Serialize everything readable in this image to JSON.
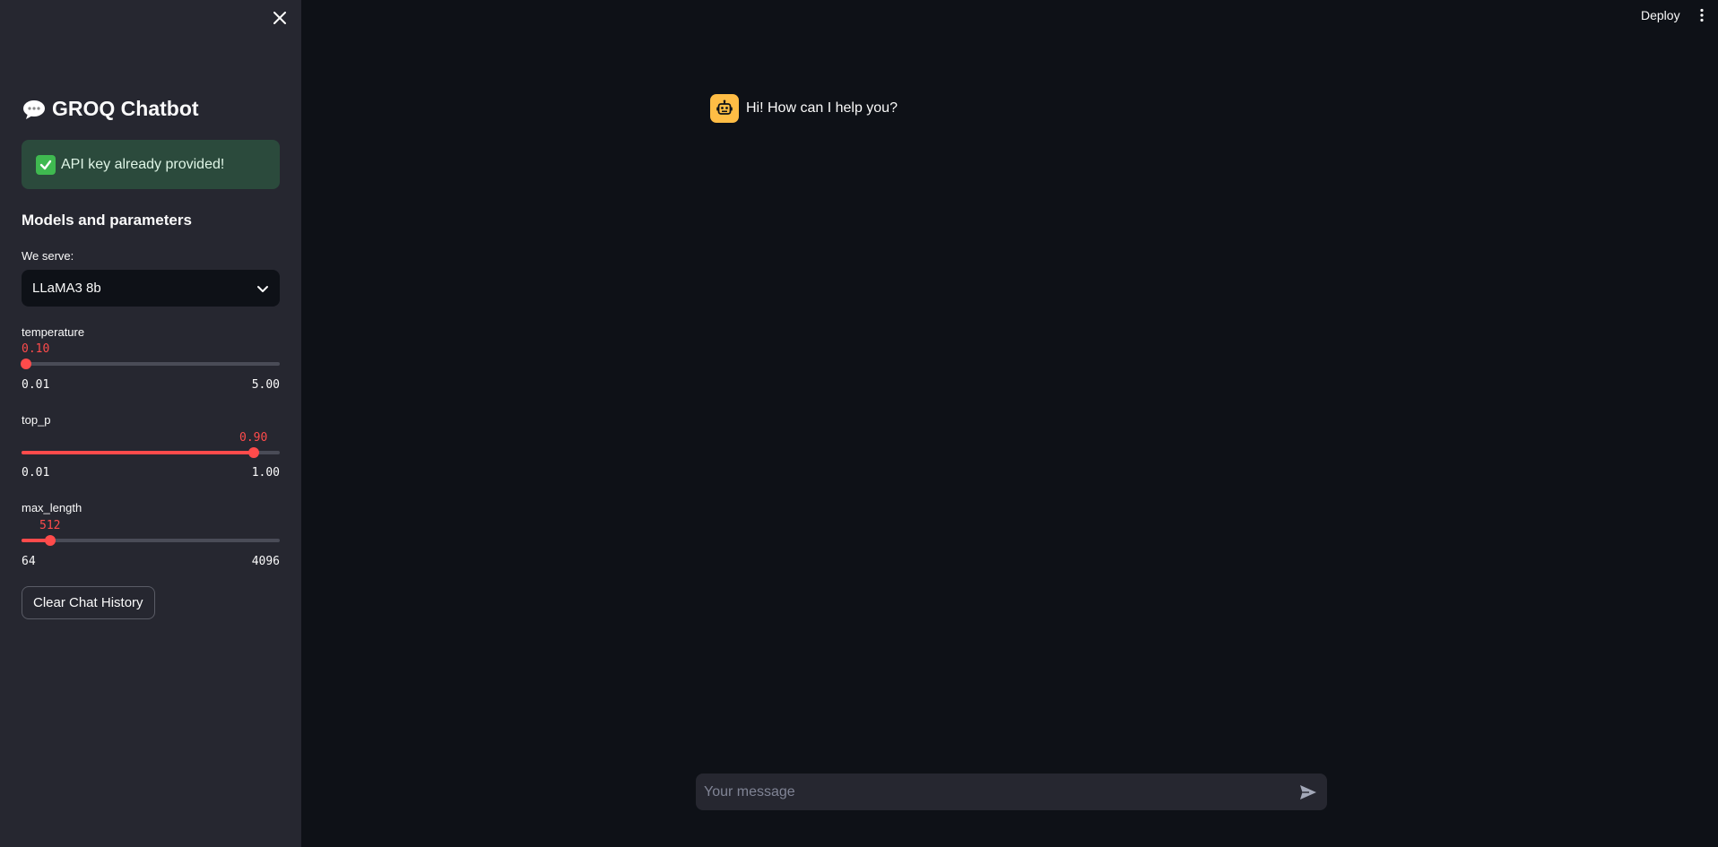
{
  "sidebar": {
    "title": "GROQ Chatbot",
    "title_icon": "speech-balloon-icon",
    "success_message": "API key already provided!",
    "success_icon": "check-mark-icon",
    "section_heading": "Models and parameters",
    "model_select": {
      "label": "We serve:",
      "value": "LLaMA3 8b"
    },
    "sliders": [
      {
        "label": "temperature",
        "value": "0.10",
        "min": "0.01",
        "max": "5.00",
        "fraction": 0.018
      },
      {
        "label": "top_p",
        "value": "0.90",
        "min": "0.01",
        "max": "1.00",
        "fraction": 0.899
      },
      {
        "label": "max_length",
        "value": "512",
        "min": "64",
        "max": "4096",
        "fraction": 0.111
      }
    ],
    "clear_button": "Clear Chat History"
  },
  "header": {
    "deploy_label": "Deploy",
    "menu_icon": "vertical-ellipsis-icon"
  },
  "chat": {
    "messages": [
      {
        "role": "assistant",
        "avatar_icon": "robot-icon",
        "text": "Hi! How can I help you?"
      }
    ],
    "input_placeholder": "Your message",
    "send_icon": "send-icon"
  },
  "colors": {
    "background": "#0e1117",
    "sidebar": "#262730",
    "accent": "#ff4b4b",
    "success_bg": "#2b4a3c",
    "avatar": "#ffbd45"
  }
}
